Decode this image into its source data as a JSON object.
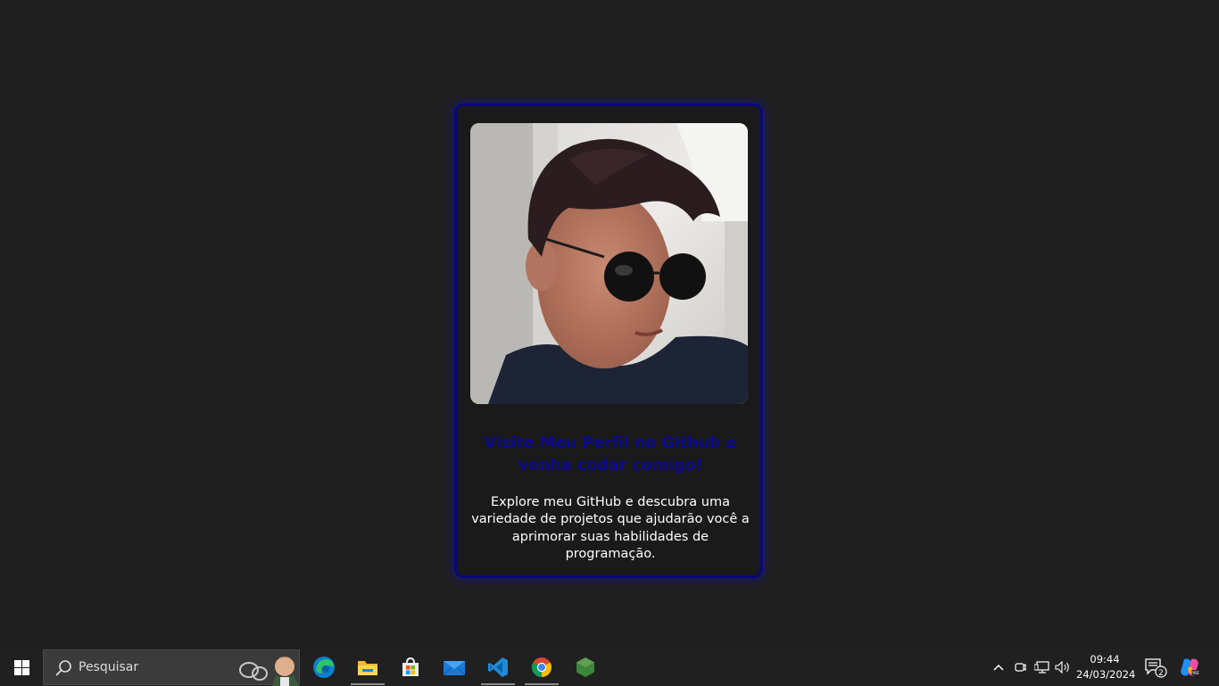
{
  "card": {
    "title": "Visite Meu Perfil no Github e venha codar comigo!",
    "description": "Explore meu GitHub e descubra uma variedade de projetos que ajudarão você a aprimorar suas habilidades de programação.",
    "accent_color": "#08087a",
    "title_color": "#0a0a8c"
  },
  "taskbar": {
    "start_icon": "windows-logo-icon",
    "search": {
      "placeholder": "Pesquisar",
      "icon": "search-icon"
    },
    "apps": [
      {
        "name": "Microsoft Edge",
        "icon": "edge-icon"
      },
      {
        "name": "File Explorer",
        "icon": "folder-icon"
      },
      {
        "name": "Microsoft Store",
        "icon": "store-icon"
      },
      {
        "name": "Mail",
        "icon": "mail-icon"
      },
      {
        "name": "Visual Studio Code",
        "icon": "vscode-icon"
      },
      {
        "name": "Google Chrome",
        "icon": "chrome-icon"
      },
      {
        "name": "Node.js",
        "icon": "nodejs-icon"
      }
    ],
    "tray": {
      "time": "09:44",
      "date": "24/03/2024",
      "notifications_count": "2"
    }
  }
}
